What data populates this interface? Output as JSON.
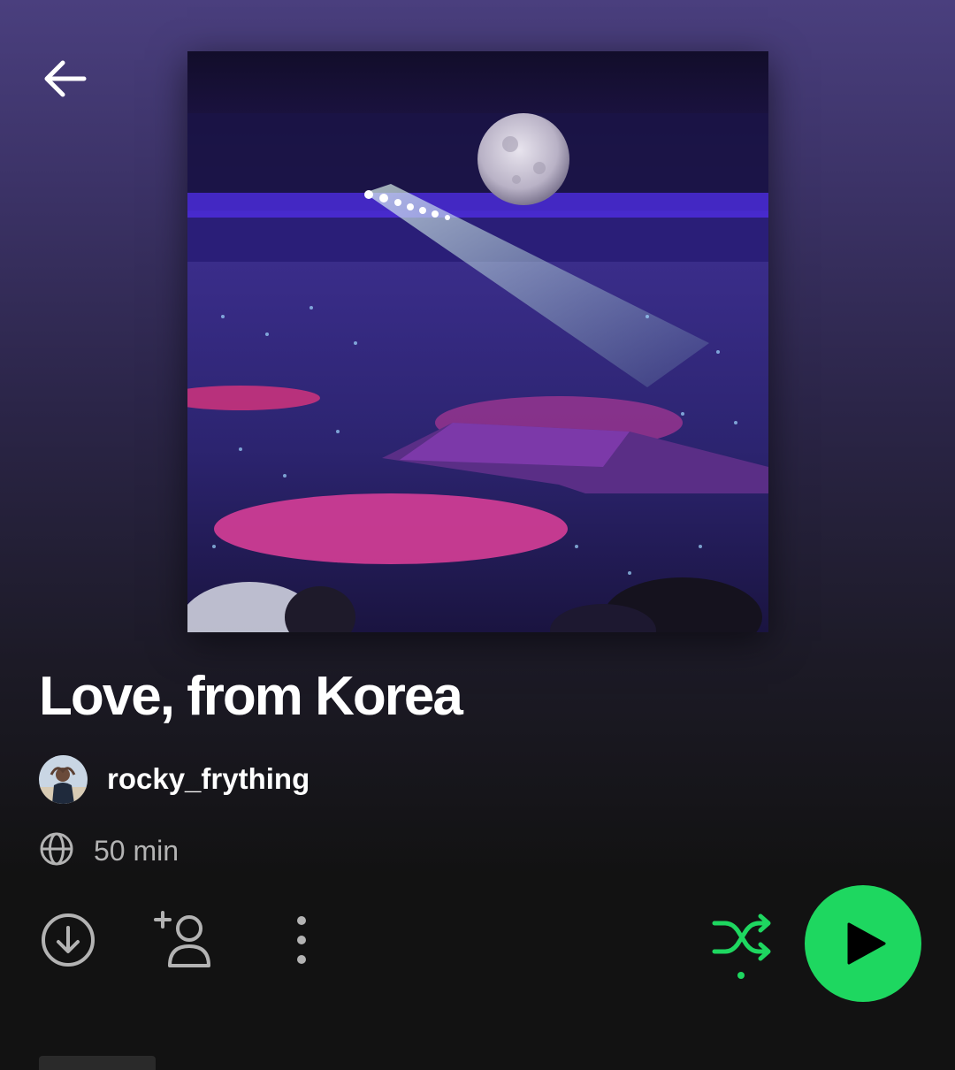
{
  "header": {
    "back_icon": "arrow-left-icon"
  },
  "playlist": {
    "cover_description_icon": "concert-arena-cover-image",
    "title": "Love, from Korea",
    "owner": {
      "name": "rocky_frything",
      "avatar_icon": "user-avatar-image"
    },
    "visibility_icon": "globe-icon",
    "duration": "50 min"
  },
  "actions": {
    "download_icon": "download-circle-icon",
    "add_user_icon": "add-user-icon",
    "more_icon": "more-vertical-icon",
    "shuffle_icon": "shuffle-icon",
    "play_icon": "play-icon"
  },
  "colors": {
    "accent": "#1ed760",
    "text_primary": "#ffffff",
    "text_secondary": "#b3b3b3",
    "icon_muted": "#b3b3b3",
    "background": "#121212",
    "gradient_top": "#4a3f7e"
  }
}
